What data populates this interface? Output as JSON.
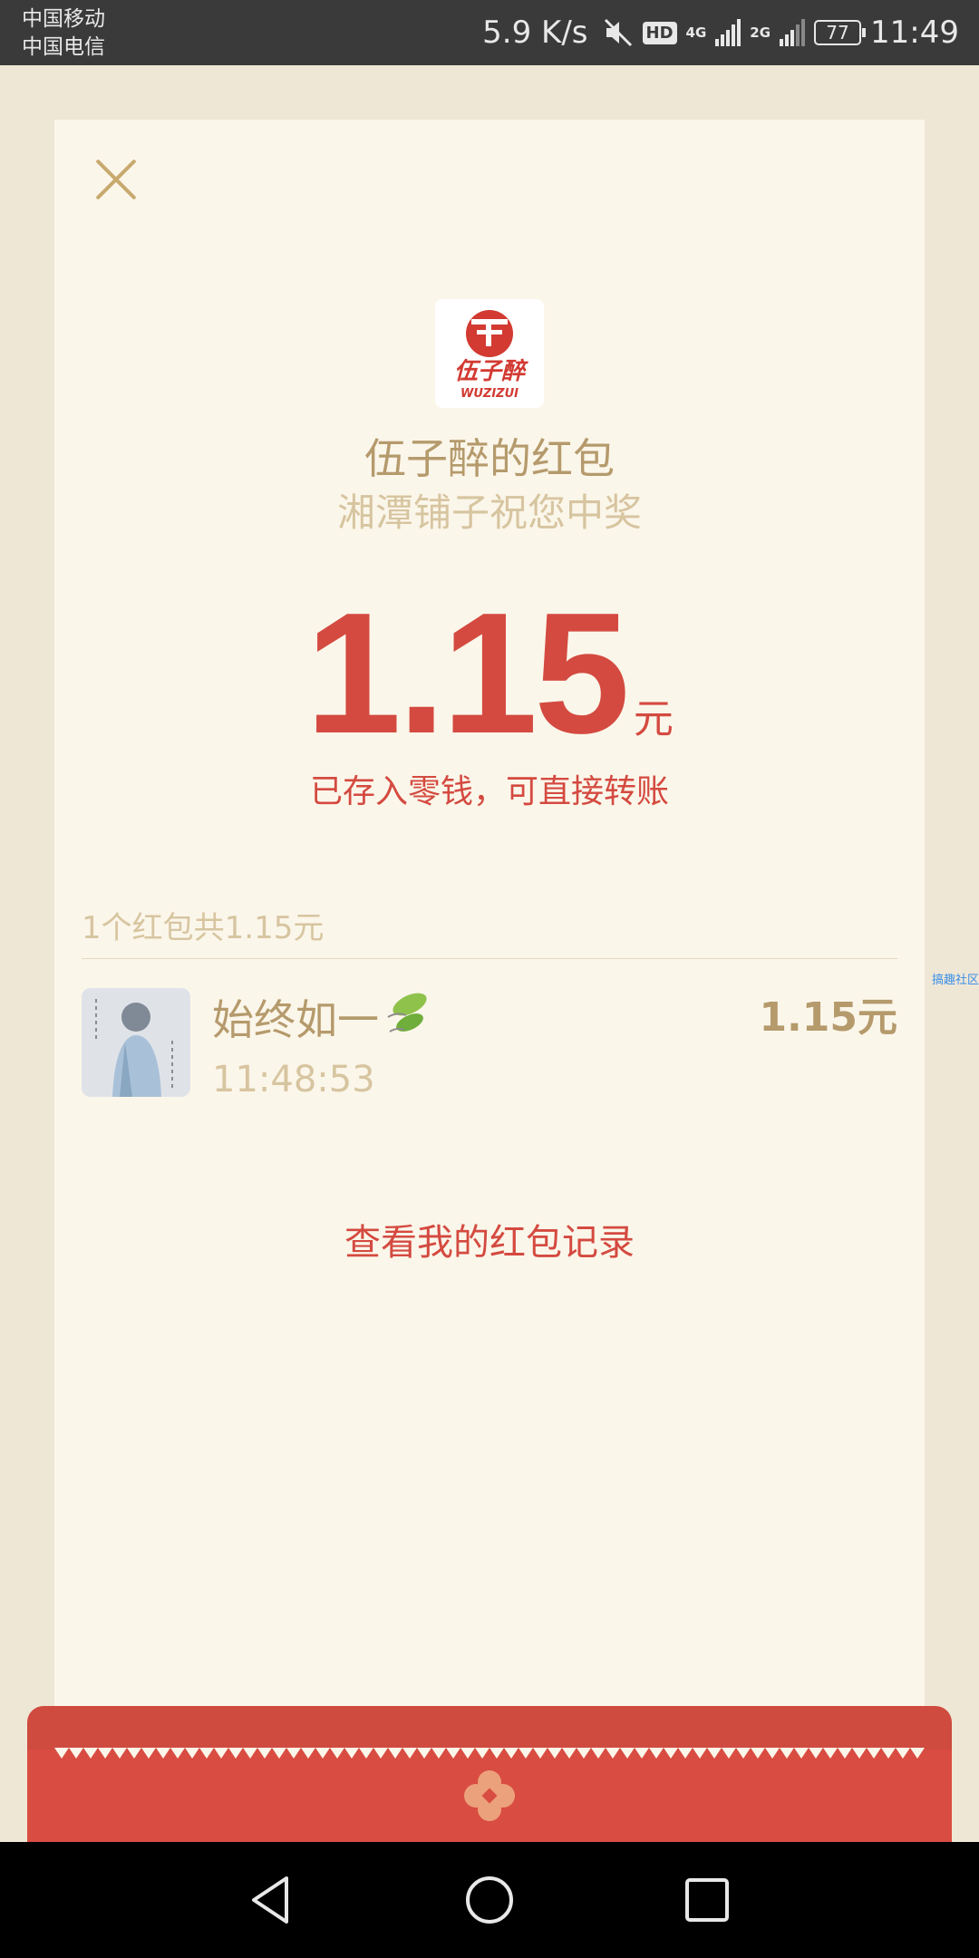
{
  "status_bar": {
    "carrier_1": "中国移动",
    "carrier_2": "中国电信",
    "net_speed": "5.9 K/s",
    "hd_badge": "HD",
    "net_1": "4G",
    "net_2": "2G",
    "battery": "77",
    "time": "11:49"
  },
  "header": {
    "sender_title": "伍子醉的红包",
    "blessing": "湘潭铺子祝您中奖",
    "logo_text_cn": "伍子醉",
    "logo_text_en": "WUZIZUI"
  },
  "amount": {
    "value": "1.15",
    "unit": "元",
    "tip": "已存入零钱，可直接转账"
  },
  "summary": "1个红包共1.15元",
  "receivers": [
    {
      "name": "始终如一",
      "time": "11:48:53",
      "amount": "1.15元"
    }
  ],
  "records_link": "查看我的红包记录",
  "watermark": "搞趣社区",
  "colors": {
    "accent_red": "#d44a40",
    "gold": "#b59a6c",
    "card_bg": "#fbf6ea",
    "page_bg": "#efe7d6"
  },
  "icons": {
    "close": "close-icon",
    "leaf": "leaf-emoji",
    "nav_back": "back-triangle-icon",
    "nav_home": "home-circle-icon",
    "nav_recent": "recent-square-icon"
  }
}
